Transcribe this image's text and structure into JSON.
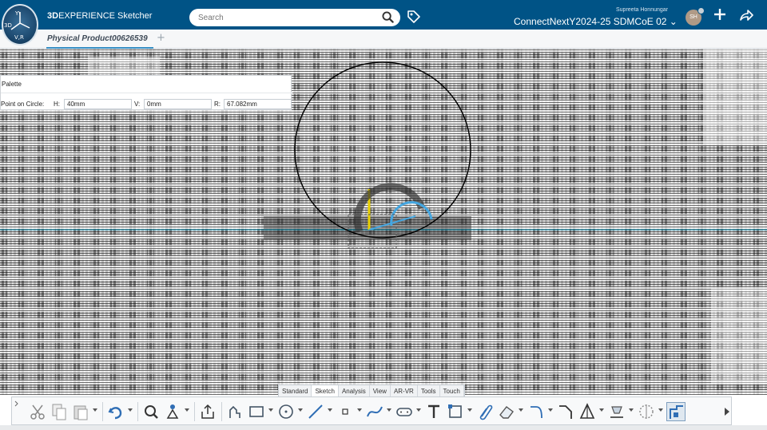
{
  "compass": {
    "top": "3D",
    "bottom": "V,R"
  },
  "app": {
    "brand_bold": "3D",
    "brand_rest": "EXPERIENCE",
    "app_name": "Sketcher"
  },
  "search": {
    "placeholder": "Search"
  },
  "user": {
    "name": "Supreeta  Honnungar",
    "initials": "SH"
  },
  "workspace": {
    "label": "ConnectNextY2024-25 SDMCoE 02"
  },
  "tabs": [
    {
      "label": "Physical Product00626539"
    }
  ],
  "palette": {
    "title": "Palette",
    "field_group_label": "Point on Circle:",
    "h_label": "H:",
    "h_value": "40mm",
    "v_label": "V:",
    "v_value": "0mm",
    "r_label": "R:",
    "r_value": "67.082mm"
  },
  "section_tabs": [
    "Standard",
    "Sketch",
    "Analysis",
    "View",
    "AR-VR",
    "Tools",
    "Touch"
  ],
  "active_section": "Sketch",
  "toolbar_icons": [
    "cut-icon",
    "copy-icon",
    "paste-icon",
    "undo-icon",
    "zoom-area-icon",
    "user-select-icon",
    "export-icon",
    "profile-icon",
    "rectangle-icon",
    "circle-icon",
    "line-icon",
    "point-icon",
    "spline-icon",
    "slot-icon",
    "text-icon",
    "corner-icon",
    "paperclip-icon",
    "eraser-icon",
    "arc-icon",
    "chamfer-icon",
    "constraint-icon",
    "project-icon",
    "symmetry-icon",
    "exit-sketch-icon"
  ],
  "colors": {
    "topbar": "#005386",
    "accent": "#368ec4",
    "axis_h": "#00a0c8",
    "axis_v": "#e8d000"
  }
}
